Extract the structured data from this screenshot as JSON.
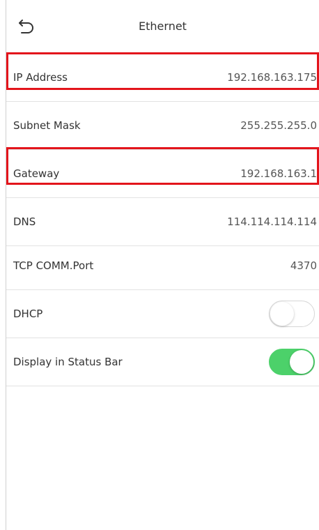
{
  "header": {
    "title": "Ethernet",
    "back_icon": "back-arrow-icon"
  },
  "rows": [
    {
      "label": "IP Address",
      "value": "192.168.163.175",
      "highlighted": true
    },
    {
      "label": "Subnet Mask",
      "value": "255.255.255.0",
      "highlighted": false
    },
    {
      "label": "Gateway",
      "value": "192.168.163.1",
      "highlighted": true
    },
    {
      "label": "DNS",
      "value": "114.114.114.114",
      "highlighted": false
    },
    {
      "label": "TCP COMM.Port",
      "value": "4370",
      "highlighted": false
    }
  ],
  "toggles": [
    {
      "label": "DHCP",
      "state": "off"
    },
    {
      "label": "Display in Status Bar",
      "state": "on"
    }
  ],
  "colors": {
    "toggle_on": "#4cd16a",
    "highlight": "#e3141b"
  }
}
